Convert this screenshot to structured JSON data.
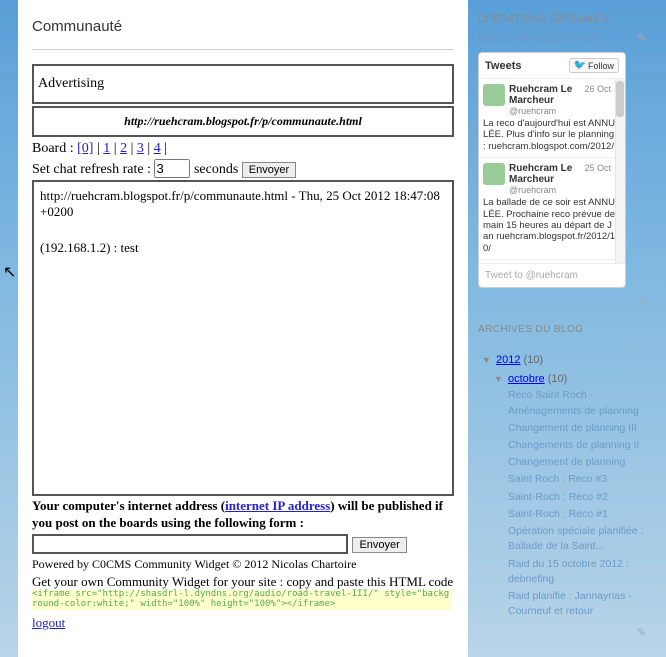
{
  "main": {
    "title": "Communauté",
    "advertising": "Advertising",
    "url": "http://ruehcram.blogspot.fr/p/communaute.html",
    "board_label": "Board : ",
    "boards": [
      "[0]",
      "1",
      "2",
      "3",
      "4"
    ],
    "refresh_label": "Set chat refresh rate : ",
    "refresh_value": "3",
    "refresh_unit": " seconds ",
    "envoyer": "Envoyer",
    "board_line1": "http://ruehcram.blogspot.fr/p/communaute.html - Thu, 25 Oct 2012 18:47:08 +0200",
    "board_line2": "(192.168.1.2) : test",
    "ip_notice_a": "Your computer's internet address (",
    "ip_link": "internet IP address",
    "ip_notice_b": ") will be published if you post on the boards using the following form :",
    "powered": "Powered by C0CMS Community Widget © 2012 Nicolas Chartoire",
    "getown": "Get your own Community Widget for your site : copy and paste this HTML code",
    "iframe_code": "<iframe src=\"http://shasdrl-l.dyndns.org/audio/road-travel-III/\" style=\"background-color:white;\" width=\"100%\" height=\"100%\"></iframe>",
    "logout": "logout"
  },
  "sidebar": {
    "ops_title": "OPÉRATIONS SPÉCIALES",
    "ops_link": "Ballade de la Saint-Roch",
    "tweets_title": "Tweets",
    "follow": "Follow",
    "tweets": [
      {
        "user": "Ruehcram Le Marcheur",
        "handle": "@ruehcram",
        "date": "26 Oct",
        "text": "La reco d'aujourd'hui est ANNULÉE. Plus d'info sur le planning : ruehcram.blogspot.com/2012/"
      },
      {
        "user": "Ruehcram Le Marcheur",
        "handle": "@ruehcram",
        "date": "25 Oct",
        "text": "La ballade de ce soir est ANNULÉE. Prochaine reco prévue demain 15 heures au départ de Jan ruehcram.blogspot.fr/2012/10/"
      }
    ],
    "tweet_to": "Tweet to @ruehcram",
    "archives_title": "ARCHIVES DU BLOG",
    "year": "2012",
    "year_count": "(10)",
    "month": "octobre",
    "month_count": "(10)",
    "posts": [
      "Reco Saint Roch - Aménagements de planning",
      "Changement de planning III",
      "Changements de planning II",
      "Changement de planning",
      "Saint Roch : Reco #3",
      "Saint-Roch : Reco #2",
      "Saint-Roch : Reco #1",
      "Opération spéciale planifiée : Ballade de la Saint...",
      "Raid du 15 octobre 2012 : debriefing",
      "Raid planifié : Jannayrias - Courneuf et retour"
    ]
  }
}
